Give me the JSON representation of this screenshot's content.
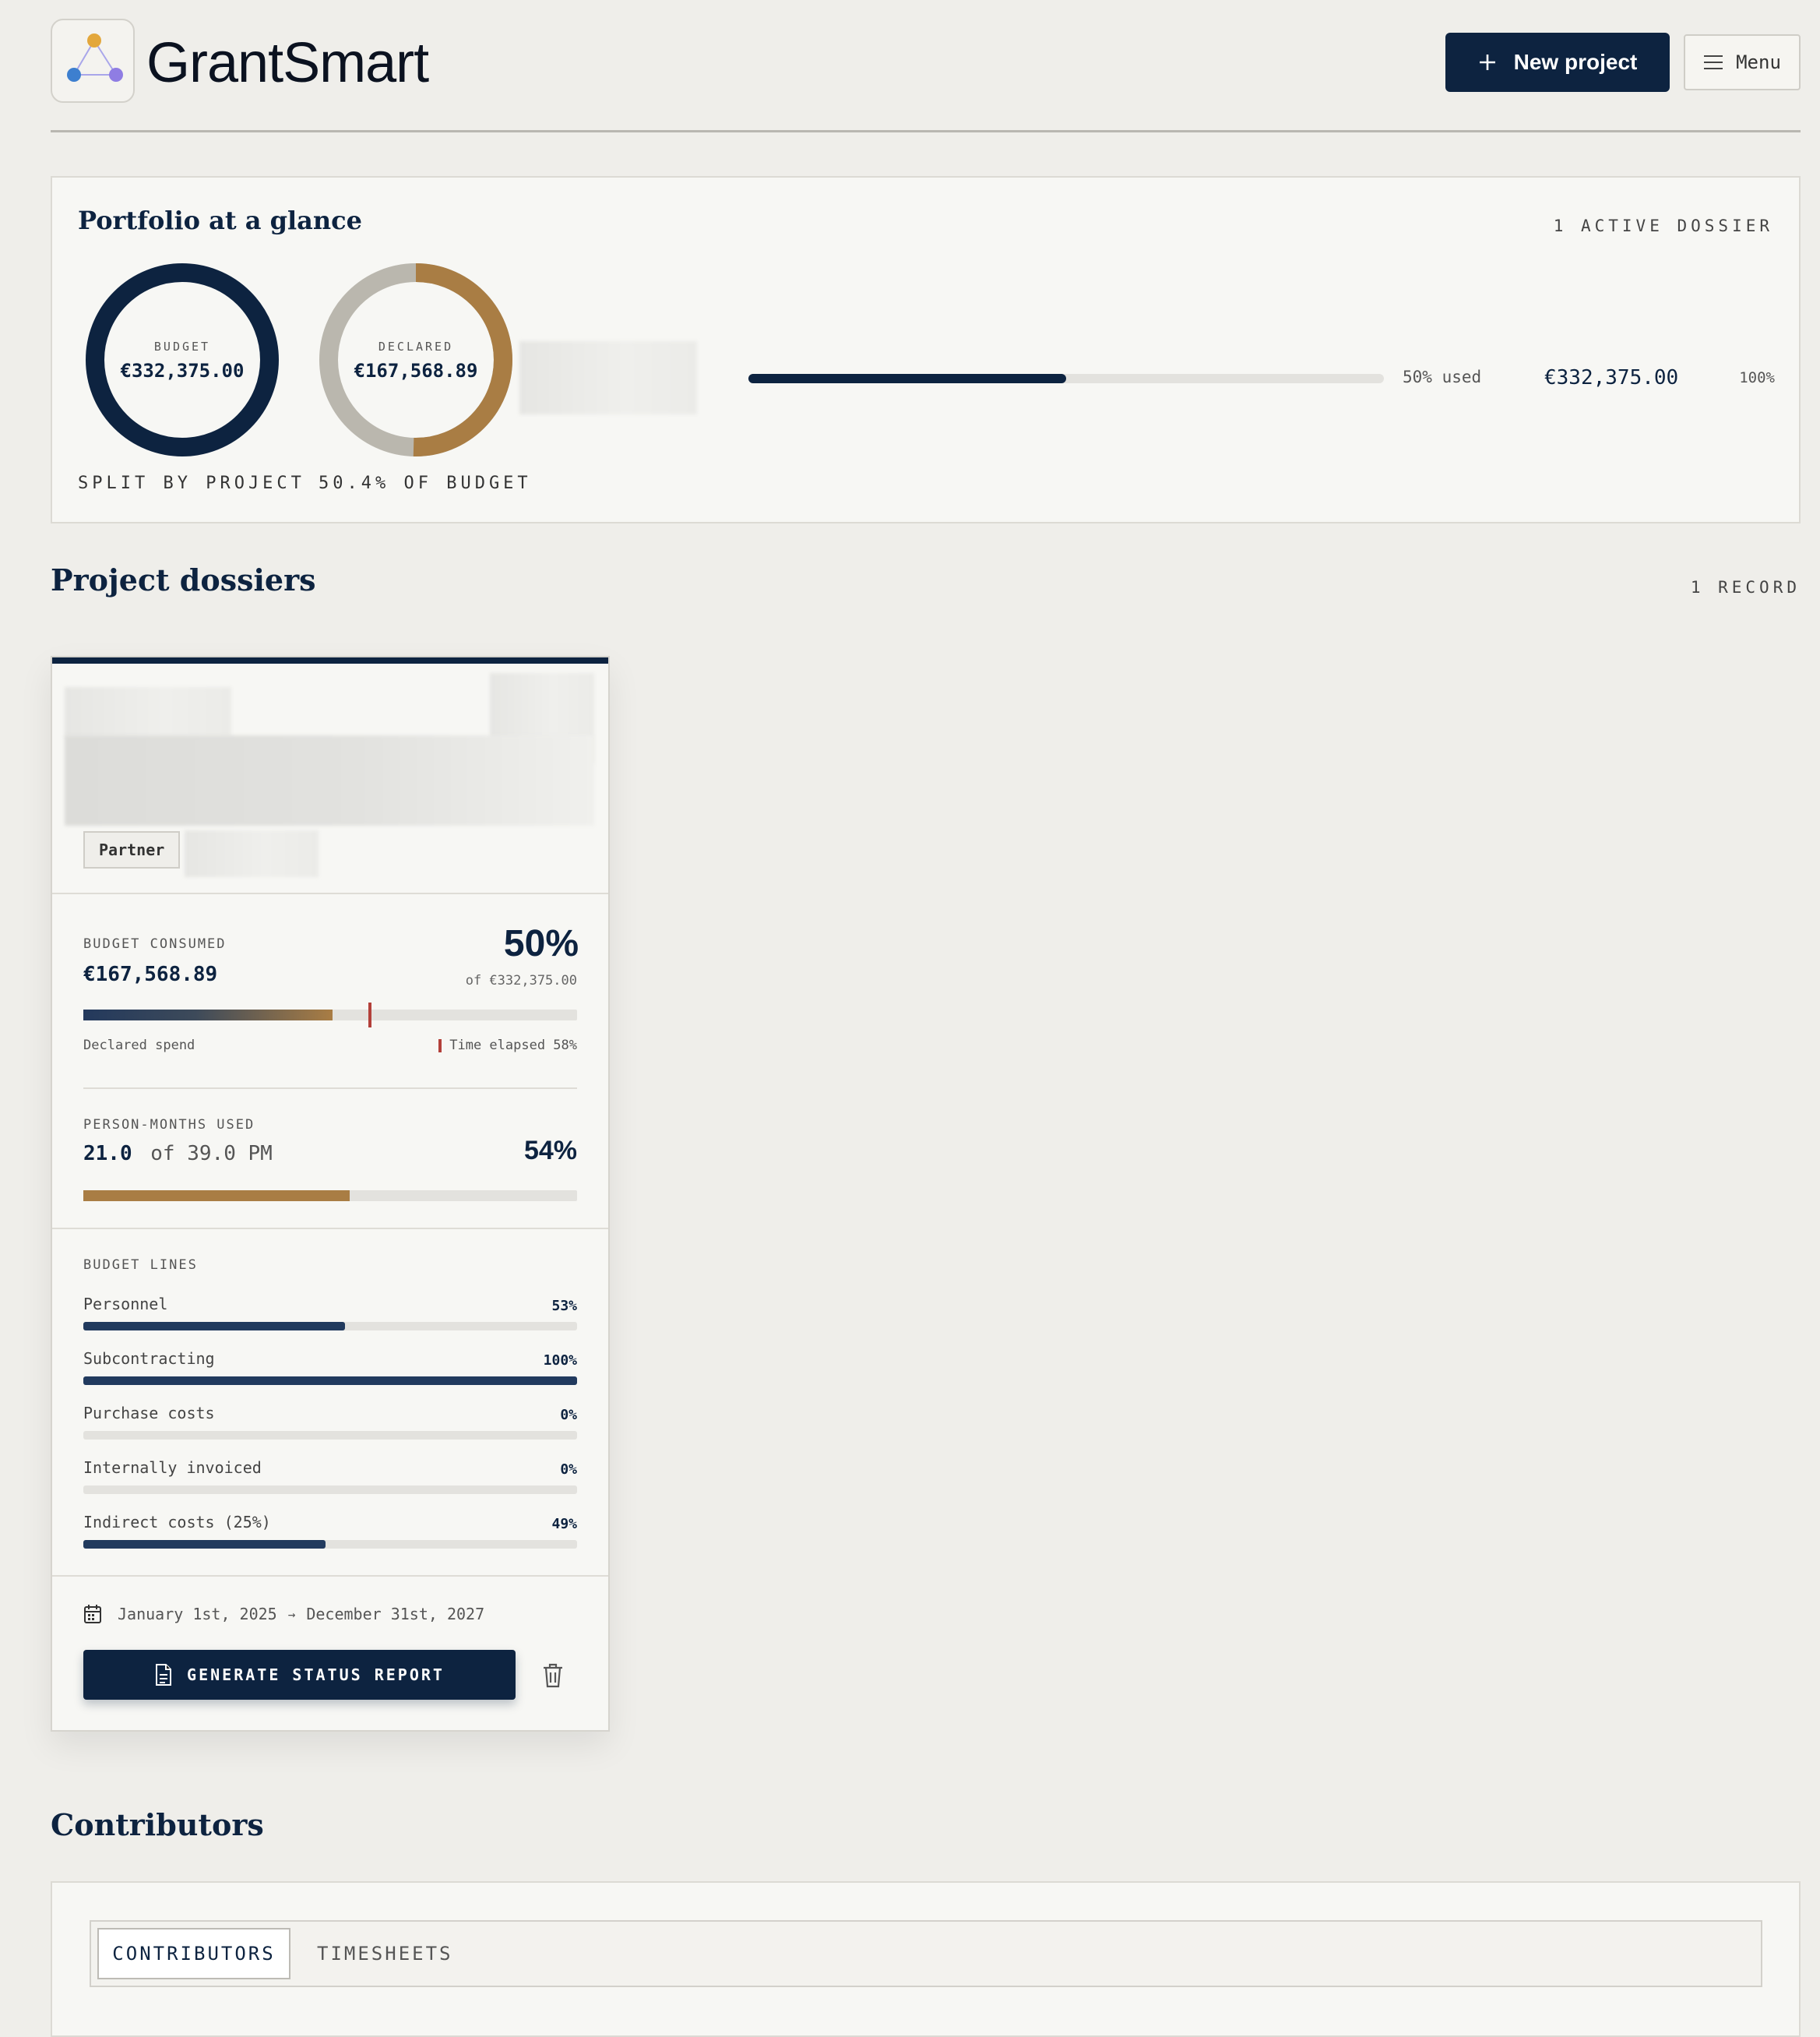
{
  "header": {
    "brand": "GrantSmart",
    "new_project_label": "New project",
    "menu_label": "Menu"
  },
  "portfolio": {
    "title": "Portfolio at a glance",
    "active_count": "1 ACTIVE DOSSIER",
    "budget_ring": {
      "label": "BUDGET",
      "value": "€332,375.00",
      "caption": "SPLIT BY PROJECT"
    },
    "declared_ring": {
      "label": "DECLARED",
      "value": "€167,568.89",
      "caption": "50.4% OF BUDGET",
      "fraction": 0.504
    },
    "usage_bar": {
      "fraction": 0.5,
      "used_label": "50% used",
      "amount": "€332,375.00",
      "percent": "100%"
    }
  },
  "dossiers": {
    "title": "Project dossiers",
    "count": "1 RECORD",
    "card": {
      "tag": "Partner",
      "budget": {
        "label": "BUDGET CONSUMED",
        "amount": "€167,568.89",
        "percent": "50%",
        "of_total": "of €332,375.00",
        "fraction": 0.505,
        "time_fraction": 0.58,
        "declared_label": "Declared spend",
        "time_label": "Time elapsed 58%"
      },
      "person_months": {
        "label": "PERSON-MONTHS USED",
        "used": "21.0",
        "of_text": "of 39.0 PM",
        "percent": "54%",
        "fraction": 0.54
      },
      "budget_lines": {
        "label": "BUDGET LINES",
        "items": [
          {
            "name": "Personnel",
            "percent": "53%",
            "fraction": 0.53
          },
          {
            "name": "Subcontracting",
            "percent": "100%",
            "fraction": 1.0
          },
          {
            "name": "Purchase costs",
            "percent": "0%",
            "fraction": 0
          },
          {
            "name": "Internally invoiced",
            "percent": "0%",
            "fraction": 0
          },
          {
            "name": "Indirect costs (25%)",
            "percent": "49%",
            "fraction": 0.49
          }
        ]
      },
      "dates": {
        "start": "January 1st, 2025",
        "arrow": "→",
        "end": "December 31st, 2027"
      },
      "report_button": "GENERATE STATUS REPORT"
    }
  },
  "contributors": {
    "title": "Contributors",
    "tabs": [
      "CONTRIBUTORS",
      "TIMESHEETS"
    ]
  },
  "colors": {
    "navy": "#0d2340",
    "bronze": "#a97d44",
    "grey_ring": "#bab7ae",
    "time_marker": "#b3403a"
  }
}
